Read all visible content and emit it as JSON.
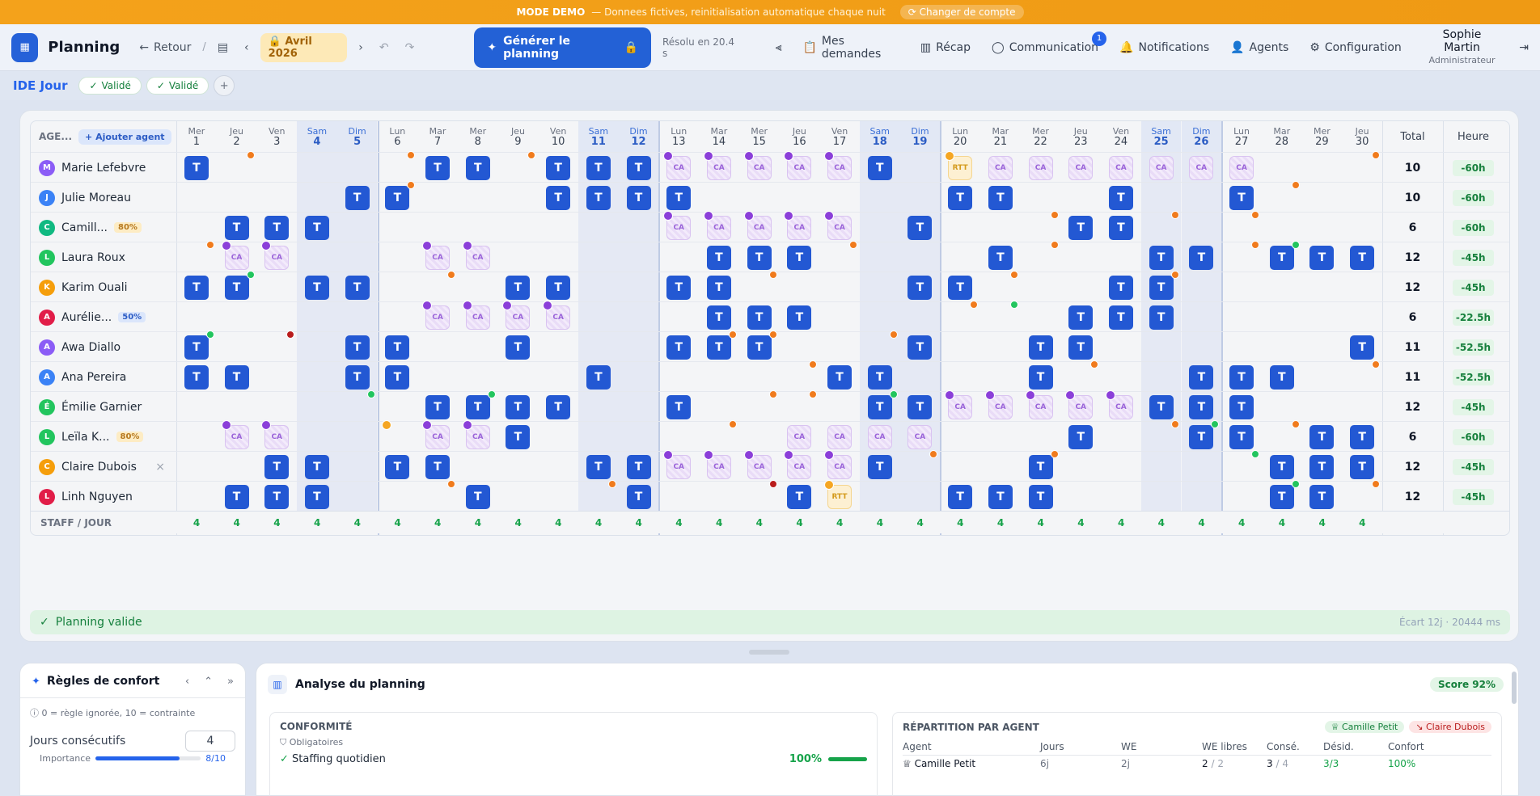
{
  "banner": {
    "mode": "MODE DEMO",
    "text": "— Donnees fictives, reinitialisation automatique chaque nuit",
    "switch": "Changer de compte"
  },
  "topbar": {
    "title": "Planning",
    "back": "Retour",
    "slash": "/",
    "month": "Avril",
    "year": "2026",
    "generate": "Générer le planning",
    "resolved": "Résolu en 20.4 s",
    "nav": [
      "Mes demandes",
      "Récap",
      "Communication",
      "Notifications",
      "Agents",
      "Configuration"
    ],
    "comm_badge": "1",
    "user_name": "Sophie Martin",
    "user_role": "Administrateur"
  },
  "subbar": {
    "title": "IDE Jour",
    "pills": [
      "Validé",
      "Validé"
    ]
  },
  "grid": {
    "agent_header": "AGE...",
    "add_agent": "Ajouter agent",
    "total_header": "Total",
    "hours_header": "Heure",
    "staff_label": "STAFF / JOUR",
    "days": [
      [
        "Mer",
        "1"
      ],
      [
        "Jeu",
        "2"
      ],
      [
        "Ven",
        "3"
      ],
      [
        "Sam",
        "4"
      ],
      [
        "Dim",
        "5"
      ],
      [
        "Lun",
        "6"
      ],
      [
        "Mar",
        "7"
      ],
      [
        "Mer",
        "8"
      ],
      [
        "Jeu",
        "9"
      ],
      [
        "Ven",
        "10"
      ],
      [
        "Sam",
        "11"
      ],
      [
        "Dim",
        "12"
      ],
      [
        "Lun",
        "13"
      ],
      [
        "Mar",
        "14"
      ],
      [
        "Mer",
        "15"
      ],
      [
        "Jeu",
        "16"
      ],
      [
        "Ven",
        "17"
      ],
      [
        "Sam",
        "18"
      ],
      [
        "Dim",
        "19"
      ],
      [
        "Lun",
        "20"
      ],
      [
        "Mar",
        "21"
      ],
      [
        "Mer",
        "22"
      ],
      [
        "Jeu",
        "23"
      ],
      [
        "Ven",
        "24"
      ],
      [
        "Sam",
        "25"
      ],
      [
        "Dim",
        "26"
      ],
      [
        "Lun",
        "27"
      ],
      [
        "Mar",
        "28"
      ],
      [
        "Mer",
        "29"
      ],
      [
        "Jeu",
        "30"
      ]
    ],
    "staff": [
      "4",
      "4",
      "4",
      "4",
      "4",
      "4",
      "4",
      "4",
      "4",
      "4",
      "4",
      "4",
      "4",
      "4",
      "4",
      "4",
      "4",
      "4",
      "4",
      "4",
      "4",
      "4",
      "4",
      "4",
      "4",
      "4",
      "4",
      "4",
      "4",
      "4"
    ],
    "agents": [
      {
        "name": "Marie Lefebvre",
        "initial": "M",
        "color": "#8b5cf6",
        "pct": "",
        "total": "10",
        "hours": "-60h",
        "cells": [
          "T",
          "",
          "",
          "",
          "",
          "",
          "T",
          "T",
          "",
          "T",
          "T",
          "T",
          "CA",
          "CA",
          "CA",
          "CA",
          "CA",
          "T",
          "",
          "RTT",
          "CA",
          "CA",
          "CA",
          "CA",
          "CA",
          "CA",
          "CA",
          "",
          "",
          ""
        ],
        "checks": [
          12,
          13,
          14,
          15,
          16
        ],
        "ochecks": [
          19
        ],
        "dots": [
          [
            1,
            "#f07b1d"
          ],
          [
            5,
            "#f07b1d"
          ],
          [
            8,
            "#f07b1d"
          ],
          [
            29,
            "#f07b1d"
          ]
        ]
      },
      {
        "name": "Julie Moreau",
        "initial": "J",
        "color": "#3b82f6",
        "pct": "",
        "total": "10",
        "hours": "-60h",
        "cells": [
          "",
          "",
          "",
          "",
          "T",
          "T",
          "",
          "",
          "",
          "T",
          "T",
          "T",
          "T",
          "",
          "",
          "",
          "",
          "",
          "",
          "T",
          "T",
          "",
          "",
          "T",
          "",
          "",
          "T",
          "",
          "",
          ""
        ],
        "checks": [],
        "ochecks": [],
        "dots": [
          [
            5,
            "#f07b1d"
          ],
          [
            27,
            "#f07b1d"
          ]
        ]
      },
      {
        "name": "Camill...",
        "initial": "C",
        "color": "#10b981",
        "pct": "80%",
        "pctc": "y",
        "total": "6",
        "hours": "-60h",
        "cells": [
          "",
          "T",
          "T",
          "T",
          "",
          "",
          "",
          "",
          "",
          "",
          "",
          "",
          "CA",
          "CA",
          "CA",
          "CA",
          "CA",
          "",
          "T",
          "",
          "",
          "",
          "T",
          "T",
          "",
          "",
          "",
          "",
          "",
          ""
        ],
        "checks": [
          12,
          13,
          14,
          15,
          16
        ],
        "ochecks": [],
        "dots": [
          [
            21,
            "#f07b1d"
          ],
          [
            24,
            "#f07b1d"
          ],
          [
            26,
            "#f07b1d"
          ]
        ]
      },
      {
        "name": "Laura Roux",
        "initial": "L",
        "color": "#22c55e",
        "pct": "",
        "total": "12",
        "hours": "-45h",
        "cells": [
          "",
          "CA",
          "CA",
          "",
          "",
          "",
          "CA",
          "CA",
          "",
          "",
          "",
          "",
          "",
          "T",
          "T",
          "T",
          "",
          "",
          "",
          "",
          "T",
          "",
          "",
          "",
          "T",
          "T",
          "",
          "T",
          "T",
          "T"
        ],
        "checks": [
          1,
          2,
          6,
          7
        ],
        "ochecks": [],
        "dots": [
          [
            0,
            "#f07b1d"
          ],
          [
            16,
            "#f07b1d"
          ],
          [
            21,
            "#f07b1d"
          ],
          [
            26,
            "#f07b1d"
          ],
          [
            27,
            "#22c55e"
          ]
        ]
      },
      {
        "name": "Karim Ouali",
        "initial": "K",
        "color": "#f59e0b",
        "pct": "",
        "total": "12",
        "hours": "-45h",
        "cells": [
          "T",
          "T",
          "",
          "T",
          "T",
          "",
          "",
          "",
          "T",
          "T",
          "",
          "",
          "T",
          "T",
          "",
          "",
          "",
          "",
          "T",
          "T",
          "",
          "",
          "",
          "T",
          "T",
          "",
          "",
          "",
          "",
          ""
        ],
        "checks": [],
        "ochecks": [],
        "dots": [
          [
            1,
            "#22c55e"
          ],
          [
            6,
            "#f07b1d"
          ],
          [
            14,
            "#f07b1d"
          ],
          [
            20,
            "#f07b1d"
          ],
          [
            24,
            "#f07b1d"
          ]
        ]
      },
      {
        "name": "Aurélie...",
        "initial": "A",
        "color": "#e11d48",
        "pct": "50%",
        "pctc": "b",
        "total": "6",
        "hours": "-22.5h",
        "cells": [
          "",
          "",
          "",
          "",
          "",
          "",
          "CA",
          "CA",
          "CA",
          "CA",
          "",
          "",
          "",
          "T",
          "T",
          "T",
          "",
          "",
          "",
          "",
          "",
          "",
          "T",
          "T",
          "T",
          "",
          "",
          "",
          "",
          ""
        ],
        "checks": [
          6,
          7,
          8,
          9
        ],
        "ochecks": [],
        "dots": [
          [
            19,
            "#f07b1d"
          ],
          [
            20,
            "#22c55e"
          ]
        ]
      },
      {
        "name": "Awa Diallo",
        "initial": "A",
        "color": "#8b5cf6",
        "pct": "",
        "total": "11",
        "hours": "-52.5h",
        "cells": [
          "T",
          "",
          "",
          "",
          "T",
          "T",
          "",
          "",
          "T",
          "",
          "",
          "",
          "T",
          "T",
          "T",
          "",
          "",
          "",
          "T",
          "",
          "",
          "T",
          "T",
          "",
          "",
          "",
          "",
          "",
          "",
          "T"
        ],
        "checks": [],
        "ochecks": [],
        "dots": [
          [
            0,
            "#22c55e"
          ],
          [
            2,
            "#b91c1c"
          ],
          [
            13,
            "#f07b1d"
          ],
          [
            14,
            "#f07b1d"
          ],
          [
            17,
            "#f07b1d"
          ]
        ]
      },
      {
        "name": "Ana Pereira",
        "initial": "A",
        "color": "#3b82f6",
        "pct": "",
        "total": "11",
        "hours": "-52.5h",
        "cells": [
          "T",
          "T",
          "",
          "",
          "T",
          "T",
          "",
          "",
          "",
          "",
          "T",
          "",
          "",
          "",
          "",
          "",
          "T",
          "T",
          "",
          "",
          "",
          "T",
          "",
          "",
          "",
          "T",
          "T",
          "T",
          "",
          ""
        ],
        "checks": [],
        "ochecks": [],
        "dots": [
          [
            15,
            "#f07b1d"
          ],
          [
            22,
            "#f07b1d"
          ],
          [
            29,
            "#f07b1d"
          ]
        ]
      },
      {
        "name": "Émilie Garnier",
        "initial": "É",
        "color": "#22c55e",
        "pct": "",
        "total": "12",
        "hours": "-45h",
        "cells": [
          "",
          "",
          "",
          "",
          "",
          "",
          "T",
          "T",
          "T",
          "T",
          "",
          "",
          "T",
          "",
          "",
          "",
          "",
          "T",
          "T",
          "CA",
          "CA",
          "CA",
          "CA",
          "CA",
          "T",
          "T",
          "T",
          "",
          "",
          ""
        ],
        "checks": [
          19,
          20,
          21,
          22,
          23
        ],
        "ochecks": [],
        "dots": [
          [
            4,
            "#22c55e"
          ],
          [
            7,
            "#22c55e"
          ],
          [
            14,
            "#f07b1d"
          ],
          [
            15,
            "#f07b1d"
          ],
          [
            17,
            "#22c55e"
          ]
        ]
      },
      {
        "name": "Leïla K...",
        "initial": "L",
        "color": "#22c55e",
        "pct": "80%",
        "pctc": "y",
        "total": "6",
        "hours": "-60h",
        "cells": [
          "",
          "CA",
          "CA",
          "",
          "",
          "",
          "CA",
          "CA",
          "T",
          "",
          "",
          "",
          "",
          "",
          "",
          "CA",
          "CA",
          "CA",
          "CA",
          "",
          "",
          "",
          "T",
          "",
          "",
          "T",
          "T",
          "",
          "T",
          "T"
        ],
        "checks": [
          1,
          2,
          6,
          7
        ],
        "ochecks": [
          5
        ],
        "dots": [
          [
            13,
            "#f07b1d"
          ],
          [
            24,
            "#f07b1d"
          ],
          [
            25,
            "#22c55e"
          ],
          [
            27,
            "#f07b1d"
          ]
        ]
      },
      {
        "name": "Claire Dubois",
        "initial": "C",
        "color": "#f59e0b",
        "pct": "",
        "close": "×",
        "total": "12",
        "hours": "-45h",
        "cells": [
          "",
          "",
          "T",
          "T",
          "",
          "T",
          "T",
          "",
          "",
          "",
          "T",
          "T",
          "CA",
          "CA",
          "CA",
          "CA",
          "CA",
          "T",
          "",
          "",
          "",
          "T",
          "",
          "",
          "",
          "",
          "",
          "T",
          "T",
          "T"
        ],
        "checks": [
          12,
          13,
          14,
          15,
          16
        ],
        "ochecks": [],
        "dots": [
          [
            18,
            "#f07b1d"
          ],
          [
            21,
            "#f07b1d"
          ],
          [
            26,
            "#22c55e"
          ]
        ]
      },
      {
        "name": "Linh Nguyen",
        "initial": "L",
        "color": "#e11d48",
        "pct": "",
        "total": "12",
        "hours": "-45h",
        "cells": [
          "",
          "T",
          "T",
          "T",
          "",
          "",
          "",
          "T",
          "",
          "",
          "",
          "T",
          "",
          "",
          "",
          "T",
          "RTT",
          "",
          "",
          "T",
          "T",
          "T",
          "",
          "",
          "",
          "",
          "",
          "T",
          "T",
          ""
        ],
        "checks": [],
        "ochecks": [
          16
        ],
        "dots": [
          [
            6,
            "#f07b1d"
          ],
          [
            10,
            "#f07b1d"
          ],
          [
            14,
            "#b91c1c"
          ],
          [
            27,
            "#22c55e"
          ],
          [
            29,
            "#f07b1d"
          ]
        ]
      }
    ]
  },
  "status": {
    "text": "Planning valide",
    "right": "Écart 12j · 20444 ms"
  },
  "rules": {
    "title": "Règles de confort",
    "hint": "0 = règle ignorée, 10 = contrainte",
    "label": "Jours consécutifs",
    "value": "4",
    "importance_label": "Importance",
    "importance": "8/10",
    "importance_level": 0.8
  },
  "analysis": {
    "title": "Analyse du planning",
    "score": "Score 92%",
    "conf_title": "CONFORMITÉ",
    "mandatory": "Obligatoires",
    "staffing": "Staffing quotidien",
    "staffing_pct": "100%",
    "staffing_level": 1.0,
    "rep_title": "RÉPARTITION PAR AGENT",
    "best": "Camille Petit",
    "worst": "Claire Dubois",
    "cols": [
      "Agent",
      "Jours",
      "WE",
      "WE libres",
      "Consé.",
      "Désid.",
      "Confort"
    ],
    "row": {
      "agent": "Camille Petit",
      "jours": "6j",
      "we": "2j",
      "welibres": "2",
      "welibres_of": "/ 2",
      "conse": "3",
      "conse_of": "/ 4",
      "desid": "3/3",
      "confort": "100%"
    }
  }
}
